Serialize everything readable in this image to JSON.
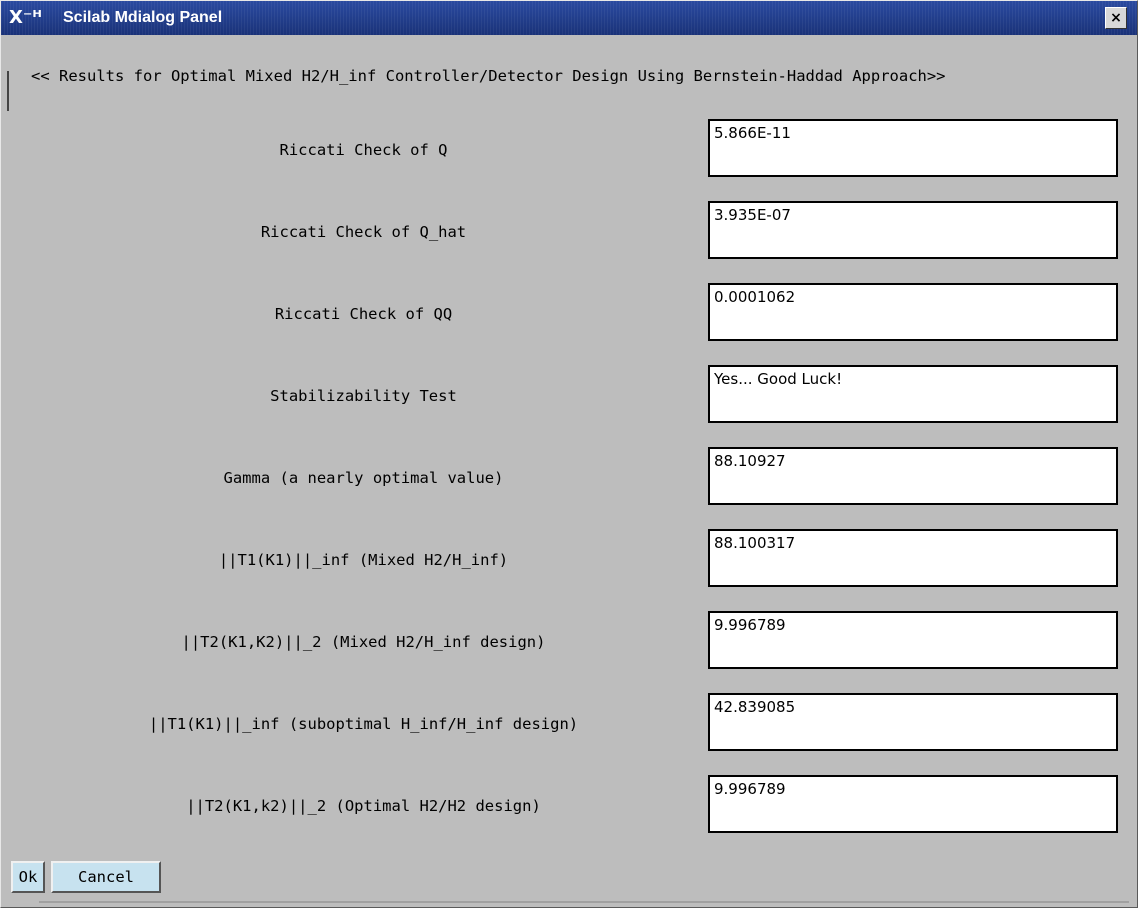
{
  "window": {
    "title": "Scilab Mdialog Panel",
    "icon_glyph": "X⁻ᴴ",
    "close_glyph": "×"
  },
  "header": "<< Results for Optimal Mixed H2/H_inf Controller/Detector Design Using Bernstein-Haddad Approach>>",
  "rows": [
    {
      "label": "Riccati Check of Q",
      "value": "5.866E-11"
    },
    {
      "label": "Riccati Check of Q_hat",
      "value": "3.935E-07"
    },
    {
      "label": "Riccati Check of QQ",
      "value": "0.0001062"
    },
    {
      "label": "Stabilizability Test",
      "value": "Yes... Good Luck!"
    },
    {
      "label": "Gamma (a nearly optimal value)",
      "value": "88.10927"
    },
    {
      "label": "||T1(K1)||_inf (Mixed H2/H_inf)",
      "value": "88.100317"
    },
    {
      "label": "||T2(K1,K2)||_2 (Mixed H2/H_inf design)",
      "value": "9.996789"
    },
    {
      "label": "||T1(K1)||_inf (suboptimal H_inf/H_inf design)",
      "value": "42.839085"
    },
    {
      "label": "||T2(K1,k2)||_2 (Optimal H2/H2 design)",
      "value": "9.996789"
    }
  ],
  "buttons": {
    "ok": "Ok",
    "cancel": "Cancel"
  },
  "colors": {
    "titlebar": "#1f3b8a",
    "background": "#bdbdbd",
    "button": "#c7e2ef"
  }
}
